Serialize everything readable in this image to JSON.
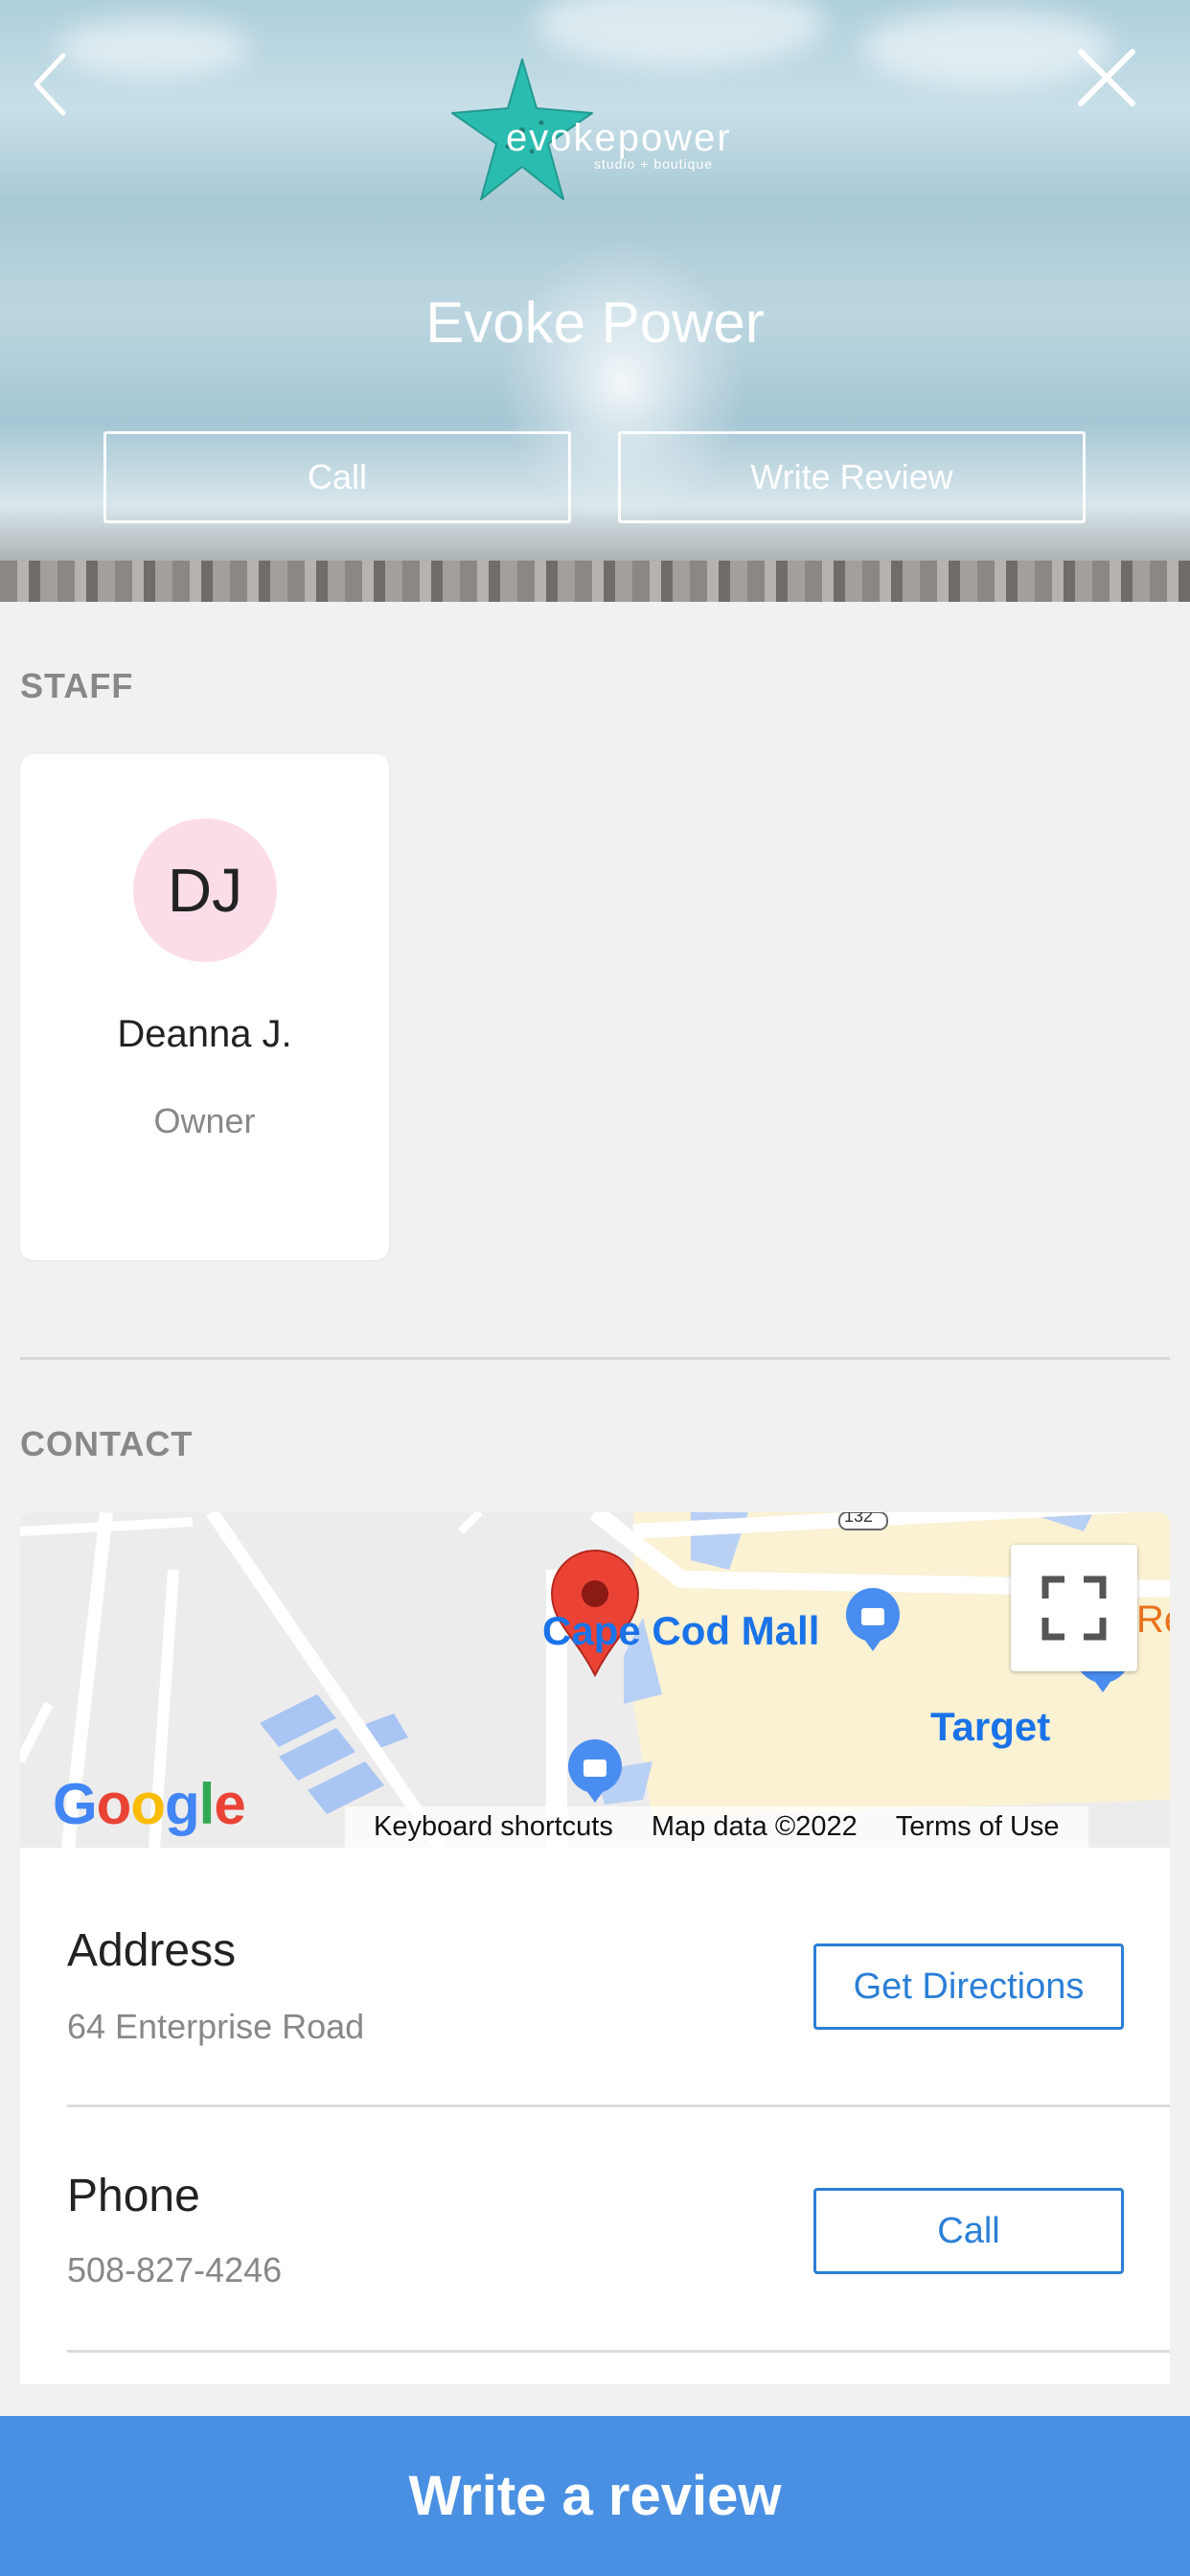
{
  "header": {
    "logo_text": "evokepower",
    "logo_subtext": "studio + boutique",
    "title": "Evoke Power",
    "call_label": "Call",
    "write_review_label": "Write Review"
  },
  "staff": {
    "section_label": "STAFF",
    "members": [
      {
        "initials": "DJ",
        "name": "Deanna J.",
        "role": "Owner",
        "avatar_color": "#fbdde9"
      }
    ]
  },
  "contact": {
    "section_label": "CONTACT",
    "map": {
      "labels": [
        "Cape Cod Mall",
        "Target",
        "Re"
      ],
      "route_number": "132",
      "footer": [
        "Keyboard shortcuts",
        "Map data ©2022",
        "Terms of Use"
      ],
      "brand": "Google"
    },
    "address": {
      "title": "Address",
      "value": "64 Enterprise Road",
      "action": "Get Directions"
    },
    "phone": {
      "title": "Phone",
      "value": "508-827-4246",
      "action": "Call"
    }
  },
  "footer": {
    "write_review_label": "Write a review"
  },
  "colors": {
    "accent": "#4a90e2",
    "link": "#2b7fd6",
    "starfish": "#2bbcb0",
    "pin": "#ea4335"
  }
}
